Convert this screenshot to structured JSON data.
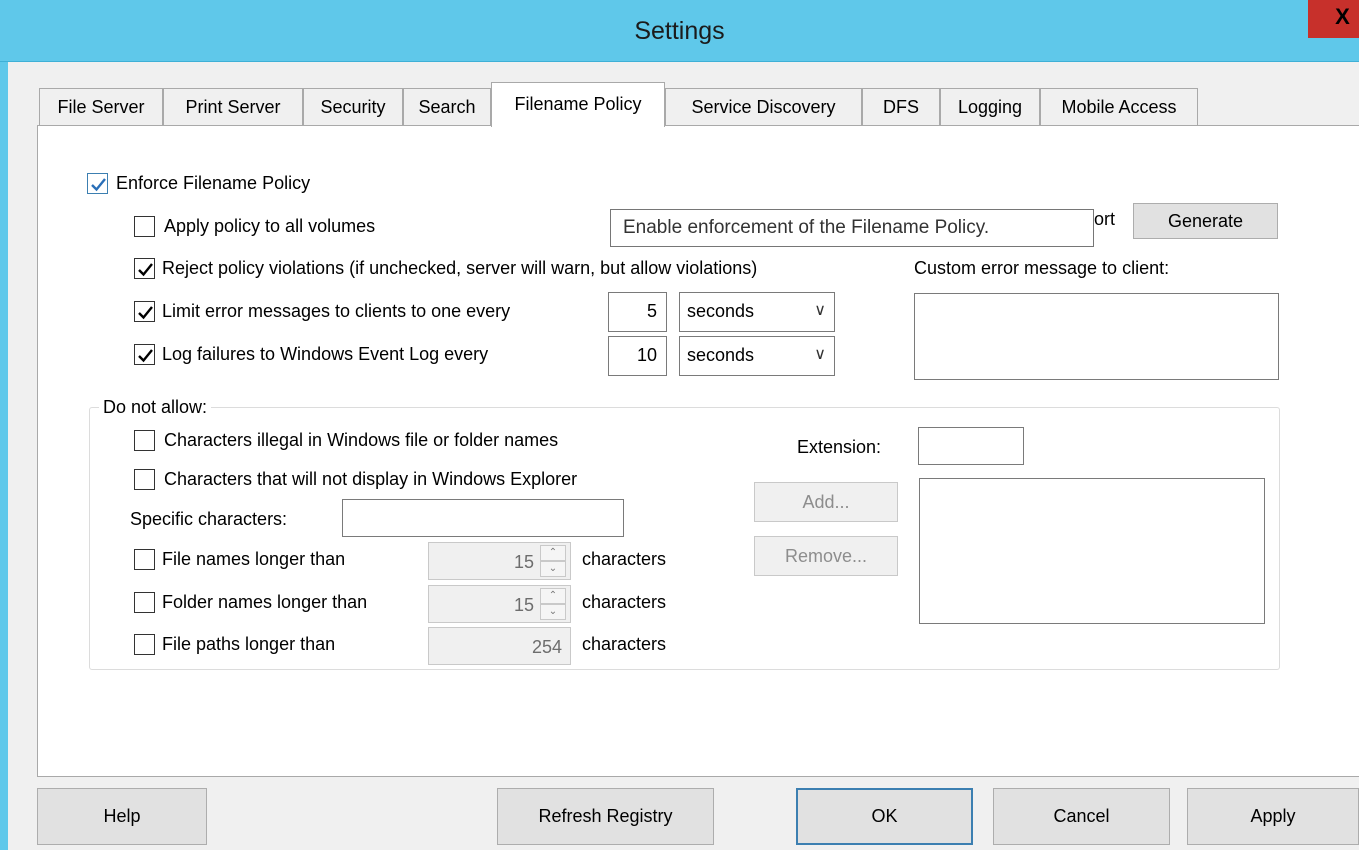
{
  "window": {
    "title": "Settings",
    "close_label": "X"
  },
  "tabs": [
    {
      "label": "File Server"
    },
    {
      "label": "Print Server"
    },
    {
      "label": "Security"
    },
    {
      "label": "Search"
    },
    {
      "label": "Filename Policy",
      "selected": true
    },
    {
      "label": "Service Discovery"
    },
    {
      "label": "DFS"
    },
    {
      "label": "Logging"
    },
    {
      "label": "Mobile Access"
    }
  ],
  "policy": {
    "enforce_label": "Enforce Filename Policy",
    "enforce_checked": true,
    "apply_all_label": "Apply policy to all volumes",
    "apply_all_checked": false,
    "reject_label": "Reject policy violations (if unchecked, server will warn, but allow violations)",
    "reject_checked": true,
    "limit_label": "Limit error messages to clients to one every",
    "limit_checked": true,
    "limit_value": "5",
    "limit_unit": "seconds",
    "log_label": "Log failures to Windows Event Log every",
    "log_checked": true,
    "log_value": "10",
    "log_unit": "seconds",
    "report_partial": "ort",
    "generate_label": "Generate",
    "custom_error_label": "Custom error message to client:",
    "custom_error_value": ""
  },
  "tooltip": "Enable enforcement of the Filename Policy.",
  "do_not_allow": {
    "group_label": "Do not allow:",
    "illegal_label": "Characters illegal in Windows file or folder names",
    "illegal_checked": false,
    "nondisplay_label": "Characters that will not display in Windows Explorer",
    "nondisplay_checked": false,
    "specific_label": "Specific characters:",
    "specific_value": "",
    "file_names_label": "File names longer than",
    "file_names_checked": false,
    "file_names_value": "15",
    "folder_names_label": "Folder names longer than",
    "folder_names_checked": false,
    "folder_names_value": "15",
    "file_paths_label": "File paths longer than",
    "file_paths_checked": false,
    "file_paths_value": "254",
    "characters_unit": "characters",
    "extension_label": "Extension:",
    "extension_value": "",
    "add_label": "Add...",
    "remove_label": "Remove..."
  },
  "footer": {
    "help": "Help",
    "refresh": "Refresh Registry",
    "ok": "OK",
    "cancel": "Cancel",
    "apply": "Apply"
  },
  "colors": {
    "titlebar": "#5fc8ea",
    "close": "#c7302b",
    "accent": "#3c7fb1"
  }
}
